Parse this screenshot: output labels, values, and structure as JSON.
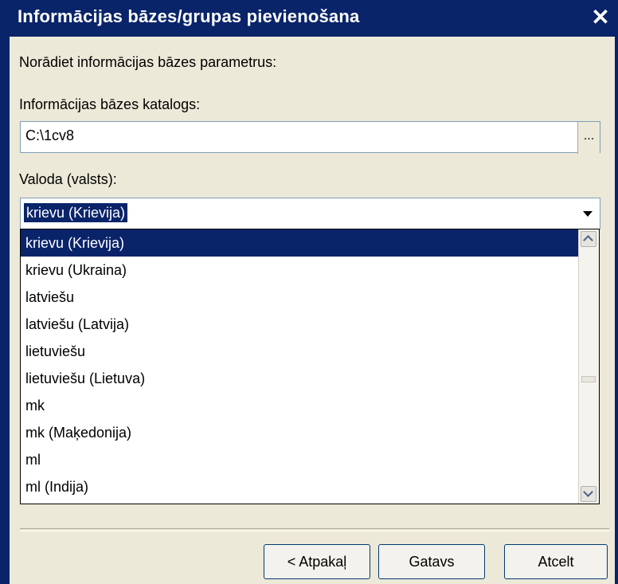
{
  "window": {
    "title": "Informācijas bāzes/grupas pievienošana",
    "close_glyph": "✕"
  },
  "intro": "Norādiet informācijas bāzes parametrus:",
  "catalog": {
    "label": "Informācijas bāzes katalogs:",
    "value": "C:\\1cv8",
    "browse_label": "..."
  },
  "language": {
    "label": "Valoda (valsts):",
    "selected": "krievu (Krievija)",
    "options": [
      "krievu (Krievija)",
      "krievu (Ukraina)",
      "latviešu",
      "latviešu (Latvija)",
      "lietuviešu",
      "lietuviešu (Lietuva)",
      "mk",
      "mk (Maķedonija)",
      "ml",
      "ml (Indija)"
    ]
  },
  "buttons": {
    "back": "< Atpakaļ",
    "done": "Gatavs",
    "cancel": "Atcelt"
  },
  "colors": {
    "titlebar": "#0a246a",
    "selection": "#0a246a",
    "dialog_bg": "#ece9d8"
  }
}
